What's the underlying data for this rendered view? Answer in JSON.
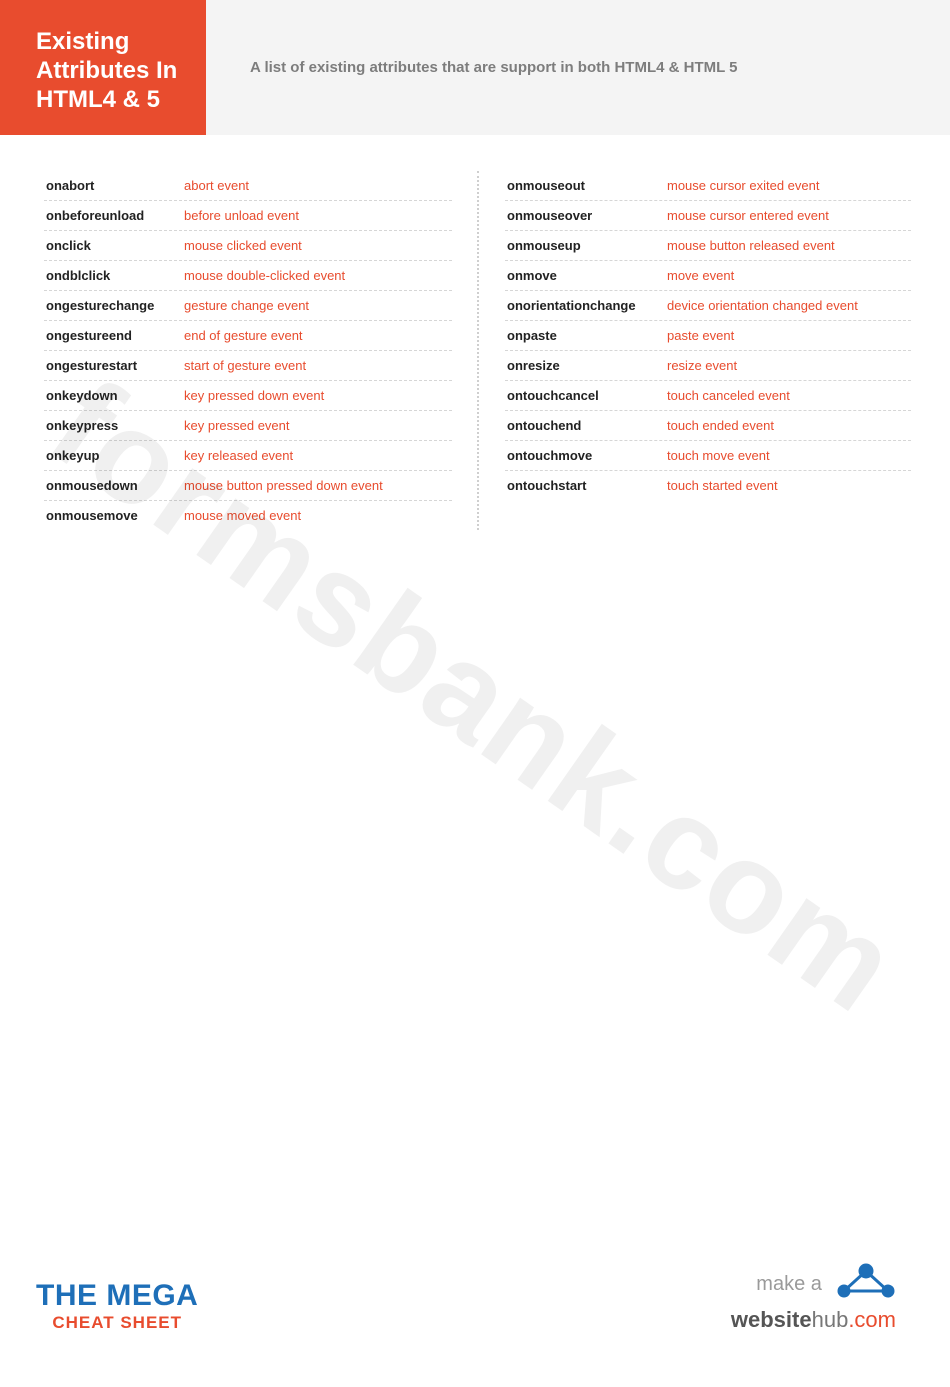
{
  "header": {
    "title_lines": [
      "Existing",
      "Attributes In",
      "HTML4 & 5"
    ],
    "subtitle": "A list of existing attributes that are support in both HTML4 & HTML 5"
  },
  "left_column": [
    {
      "attr": "onabort",
      "desc": "abort event"
    },
    {
      "attr": "onbeforeunload",
      "desc": "before unload event"
    },
    {
      "attr": "onclick",
      "desc": "mouse clicked event"
    },
    {
      "attr": "ondblclick",
      "desc": "mouse double-clicked event"
    },
    {
      "attr": "ongesturechange",
      "desc": "gesture change event"
    },
    {
      "attr": "ongestureend",
      "desc": "end of gesture event"
    },
    {
      "attr": "ongesturestart",
      "desc": "start of gesture event"
    },
    {
      "attr": "onkeydown",
      "desc": "key pressed down event"
    },
    {
      "attr": "onkeypress",
      "desc": "key pressed event"
    },
    {
      "attr": "onkeyup",
      "desc": "key released event"
    },
    {
      "attr": "onmousedown",
      "desc": "mouse button pressed down event"
    },
    {
      "attr": "onmousemove",
      "desc": "mouse moved event"
    }
  ],
  "right_column": [
    {
      "attr": "onmouseout",
      "desc": "mouse cursor exited event"
    },
    {
      "attr": "onmouseover",
      "desc": "mouse cursor entered event"
    },
    {
      "attr": "onmouseup",
      "desc": "mouse button released event"
    },
    {
      "attr": "onmove",
      "desc": "move event"
    },
    {
      "attr": "onorientationchange",
      "desc": "device orientation changed event"
    },
    {
      "attr": "onpaste",
      "desc": "paste event"
    },
    {
      "attr": "onresize",
      "desc": "resize event"
    },
    {
      "attr": "ontouchcancel",
      "desc": "touch canceled event"
    },
    {
      "attr": "ontouchend",
      "desc": "touch ended event"
    },
    {
      "attr": "ontouchmove",
      "desc": "touch move event"
    },
    {
      "attr": "ontouchstart",
      "desc": "touch started event"
    }
  ],
  "watermark": "formsbank.com",
  "footer": {
    "mega_line1": "THE MEGA",
    "mega_line2": "CHEAT SHEET",
    "hub_line1": "make a",
    "hub_brand_bold": "website",
    "hub_brand_rest": "hub",
    "hub_dotcom": ".com"
  }
}
